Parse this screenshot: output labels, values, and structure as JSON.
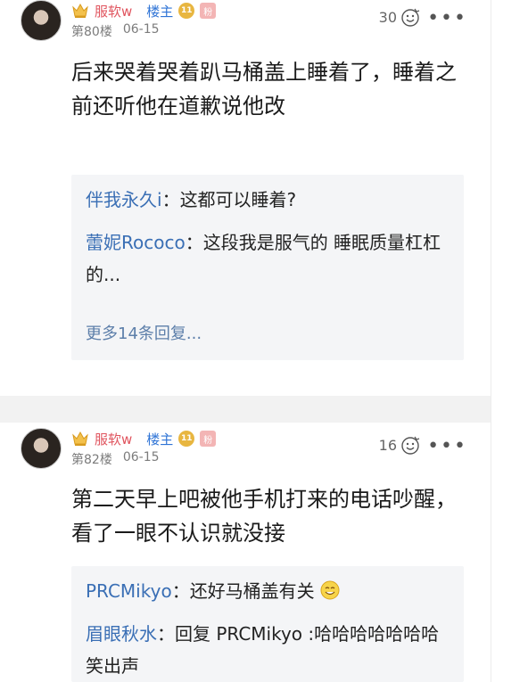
{
  "posts": [
    {
      "username": "服软w",
      "host_tag": "楼主",
      "level_badge": "11",
      "fan_badge": "粉",
      "floor": "第80楼",
      "date": "06-15",
      "like_count": "30",
      "content": "后来哭着哭着趴马桶盖上睡着了，睡着之前还听他在道歉说他改",
      "replies": [
        {
          "name": "伴我永久i",
          "sep": "：",
          "text": "这都可以睡着?"
        },
        {
          "name": "蕾妮Rococo",
          "sep": "：",
          "text": "这段我是服气的 睡眠质量杠杠的..."
        }
      ],
      "more_replies": "更多14条回复..."
    },
    {
      "username": "服软w",
      "host_tag": "楼主",
      "level_badge": "11",
      "fan_badge": "粉",
      "floor": "第82楼",
      "date": "06-15",
      "like_count": "16",
      "content": "第二天早上吧被他手机打来的电话吵醒，看了一眼不认识就没接",
      "replies": [
        {
          "name": "PRCMikyo",
          "sep": "：",
          "text": "还好马桶盖有关"
        },
        {
          "name": "眉眼秋水",
          "sep": "：",
          "text": "回复 PRCMikyo :哈哈哈哈哈哈哈笑出声"
        }
      ]
    }
  ],
  "icons": {
    "crown": "crown-icon",
    "like": "like-icon",
    "more": "more-icon",
    "smile": "smile-icon"
  },
  "colors": {
    "username": "#e0545e",
    "host_tag": "#2f74d6",
    "reply_name": "#3a6fb5",
    "reply_bg": "#f4f5f7"
  }
}
